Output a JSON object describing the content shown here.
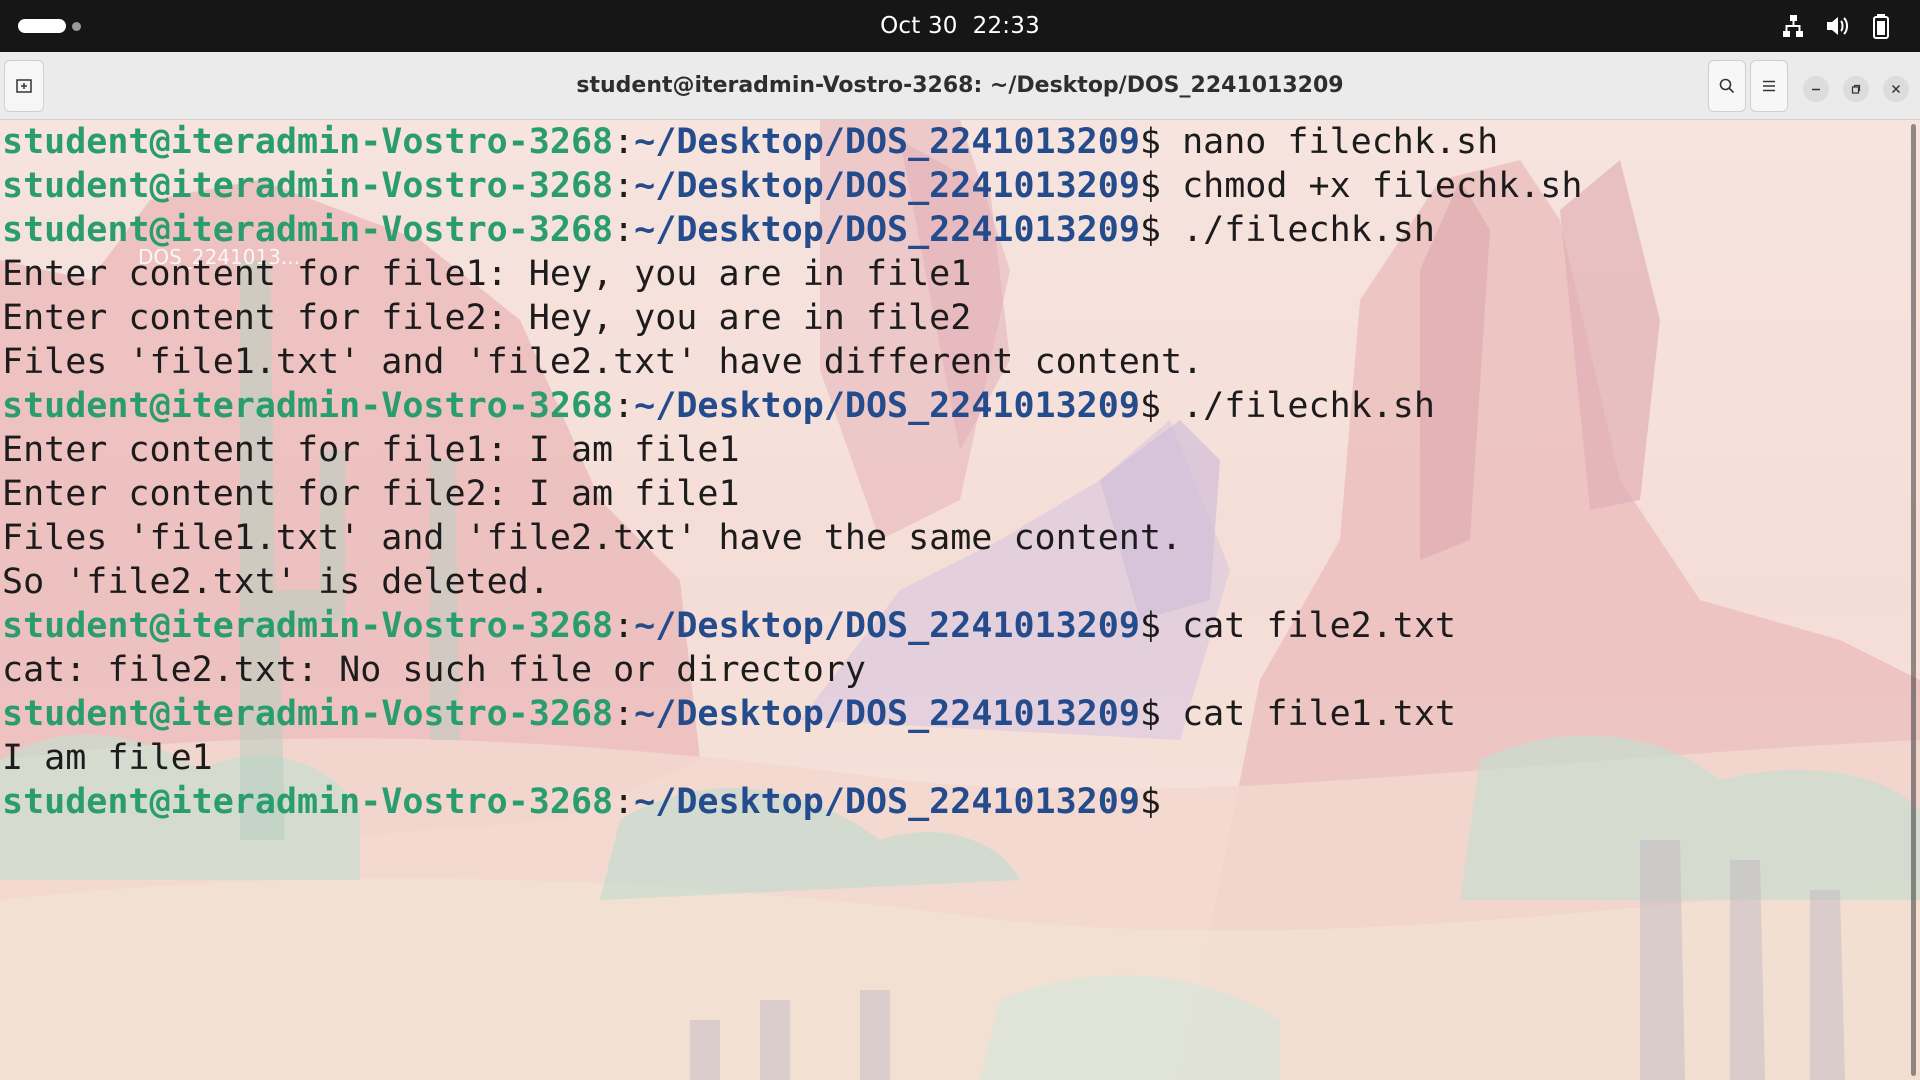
{
  "topbar": {
    "date": "Oct 30",
    "time": "22:33",
    "icons": [
      "activities-icon",
      "network-icon",
      "volume-icon",
      "battery-icon"
    ]
  },
  "window": {
    "title": "student@iteradmin-Vostro-3268: ~/Desktop/DOS_2241013209",
    "buttons": [
      "new-tab-icon",
      "search-icon",
      "hamburger-menu-icon",
      "minimize-icon",
      "maximize-icon",
      "close-icon"
    ]
  },
  "desktop": {
    "icon_label": "DOS_2241013..."
  },
  "terminal": {
    "prompt_user": "student@iteradmin-Vostro-3268",
    "prompt_colon": ":",
    "prompt_path": "~/Desktop/DOS_2241013209",
    "prompt_symbol": "$",
    "colors": {
      "user_host": "#2a9d6f",
      "path": "#244b8c",
      "text": "#1c1c1c"
    },
    "lines": [
      {
        "type": "cmd",
        "command": "nano filechk.sh"
      },
      {
        "type": "cmd",
        "command": "chmod +x filechk.sh"
      },
      {
        "type": "cmd",
        "command": "./filechk.sh"
      },
      {
        "type": "out",
        "text": "Enter content for file1: Hey, you are in file1"
      },
      {
        "type": "out",
        "text": "Enter content for file2: Hey, you are in file2"
      },
      {
        "type": "out",
        "text": "Files 'file1.txt' and 'file2.txt' have different content."
      },
      {
        "type": "cmd",
        "command": "./filechk.sh"
      },
      {
        "type": "out",
        "text": "Enter content for file1: I am file1"
      },
      {
        "type": "out",
        "text": "Enter content for file2: I am file1"
      },
      {
        "type": "out",
        "text": "Files 'file1.txt' and 'file2.txt' have the same content."
      },
      {
        "type": "out",
        "text": "So 'file2.txt' is deleted."
      },
      {
        "type": "cmd",
        "command": "cat file2.txt"
      },
      {
        "type": "out",
        "text": "cat: file2.txt: No such file or directory"
      },
      {
        "type": "cmd",
        "command": "cat file1.txt"
      },
      {
        "type": "out",
        "text": "I am file1"
      },
      {
        "type": "cmd",
        "command": ""
      }
    ]
  }
}
